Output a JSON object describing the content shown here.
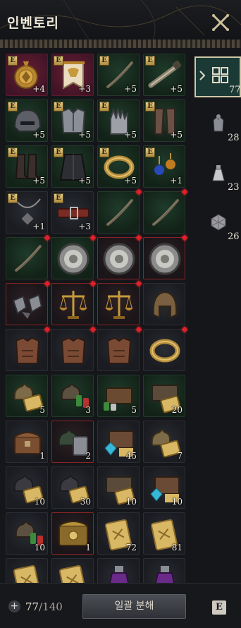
{
  "window": {
    "title": "인벤토리"
  },
  "footer": {
    "count": "77",
    "max": "/140",
    "button_label": "일괄 분해",
    "key_hint": "E"
  },
  "badge_text": "E",
  "colors": {
    "new_marker": "#e0202a",
    "selected_border": "#8a2426",
    "accent_teal": "#1c3a35",
    "badge_gold": "#d8b864"
  },
  "sidebar": {
    "tabs": [
      {
        "icon": "grid-icon",
        "count": "77",
        "active": true
      },
      {
        "icon": "armor-icon",
        "count": "28",
        "active": false
      },
      {
        "icon": "potion-icon",
        "count": "23",
        "active": false
      },
      {
        "icon": "dice-icon",
        "count": "26",
        "active": false
      }
    ]
  },
  "items": [
    {
      "icon": "medallion",
      "bg": "crim",
      "badge": true,
      "count": "+4",
      "new": false
    },
    {
      "icon": "banner",
      "bg": "crim",
      "badge": true,
      "count": "+3",
      "new": false
    },
    {
      "icon": "bow",
      "bg": "green",
      "badge": true,
      "count": "+5",
      "new": false
    },
    {
      "icon": "spyglass",
      "bg": "green",
      "badge": true,
      "count": "+5",
      "new": false
    },
    {
      "icon": "helmet-round",
      "bg": "green",
      "badge": true,
      "count": "+5",
      "new": false
    },
    {
      "icon": "chestplate",
      "bg": "green",
      "badge": true,
      "count": "+5",
      "new": false
    },
    {
      "icon": "gauntlet",
      "bg": "green",
      "badge": true,
      "count": "+5",
      "new": false
    },
    {
      "icon": "greaves",
      "bg": "green",
      "badge": true,
      "count": "+5",
      "new": false
    },
    {
      "icon": "boots",
      "bg": "green",
      "badge": true,
      "count": "+5",
      "new": false
    },
    {
      "icon": "cloak",
      "bg": "green",
      "badge": true,
      "count": "+5",
      "new": false
    },
    {
      "icon": "ring",
      "bg": "green",
      "badge": true,
      "count": "+5",
      "new": false
    },
    {
      "icon": "earring",
      "bg": "green",
      "badge": true,
      "count": "+1",
      "new": false
    },
    {
      "icon": "necklace",
      "bg": "dark",
      "badge": true,
      "count": "+1",
      "new": false
    },
    {
      "icon": "belt",
      "bg": "dark",
      "badge": true,
      "count": "+3",
      "new": false
    },
    {
      "icon": "bow",
      "bg": "green",
      "badge": false,
      "count": "",
      "new": true
    },
    {
      "icon": "bow",
      "bg": "green",
      "badge": false,
      "count": "",
      "new": true
    },
    {
      "icon": "bow",
      "bg": "green",
      "badge": false,
      "count": "",
      "new": true
    },
    {
      "icon": "shield",
      "bg": "green",
      "badge": false,
      "count": "",
      "new": true
    },
    {
      "icon": "shield",
      "bg": "red",
      "badge": false,
      "count": "",
      "new": true
    },
    {
      "icon": "shield",
      "bg": "red",
      "badge": false,
      "count": "",
      "new": true
    },
    {
      "icon": "gauntlet-pair",
      "bg": "red",
      "badge": false,
      "count": "",
      "new": true
    },
    {
      "icon": "scales",
      "bg": "red",
      "badge": false,
      "count": "",
      "new": true
    },
    {
      "icon": "scales",
      "bg": "red",
      "badge": false,
      "count": "",
      "new": true
    },
    {
      "icon": "helmet-crest",
      "bg": "dark",
      "badge": false,
      "count": "",
      "new": false
    },
    {
      "icon": "leather-armor",
      "bg": "dark",
      "badge": false,
      "count": "",
      "new": true
    },
    {
      "icon": "leather-armor",
      "bg": "dark",
      "badge": false,
      "count": "",
      "new": true
    },
    {
      "icon": "leather-armor",
      "bg": "dark",
      "badge": false,
      "count": "",
      "new": true
    },
    {
      "icon": "ring",
      "bg": "dark",
      "badge": false,
      "count": "",
      "new": true
    },
    {
      "icon": "pouch-scroll",
      "bg": "green",
      "badge": false,
      "count": "5",
      "new": false
    },
    {
      "icon": "pouch-bottles",
      "bg": "green",
      "badge": false,
      "count": "3",
      "new": false
    },
    {
      "icon": "chest-bottles",
      "bg": "green",
      "badge": false,
      "count": "5",
      "new": false
    },
    {
      "icon": "chest-scroll",
      "bg": "green",
      "badge": false,
      "count": "20",
      "new": false
    },
    {
      "icon": "chest",
      "bg": "dark",
      "badge": false,
      "count": "1",
      "new": false
    },
    {
      "icon": "pouch-card",
      "bg": "red",
      "badge": false,
      "count": "2",
      "new": false
    },
    {
      "icon": "chest-gems",
      "bg": "dark",
      "badge": false,
      "count": "45",
      "new": false
    },
    {
      "icon": "pouch-scroll",
      "bg": "dark",
      "badge": false,
      "count": "7",
      "new": false
    },
    {
      "icon": "pouch-scroll-dark",
      "bg": "dark",
      "badge": false,
      "count": "10",
      "new": false
    },
    {
      "icon": "pouch-scroll-dark",
      "bg": "dark",
      "badge": false,
      "count": "30",
      "new": false
    },
    {
      "icon": "chest-scroll",
      "bg": "dark",
      "badge": false,
      "count": "10",
      "new": false
    },
    {
      "icon": "chest-gems",
      "bg": "dark",
      "badge": false,
      "count": "10",
      "new": false
    },
    {
      "icon": "pouch-bottles",
      "bg": "dark",
      "badge": false,
      "count": "10",
      "new": false
    },
    {
      "icon": "gold-chest",
      "bg": "red",
      "badge": false,
      "count": "1",
      "new": false
    },
    {
      "icon": "scroll",
      "bg": "dark",
      "badge": false,
      "count": "72",
      "new": false
    },
    {
      "icon": "scroll",
      "bg": "dark",
      "badge": false,
      "count": "81",
      "new": false
    },
    {
      "icon": "scroll",
      "bg": "dark",
      "badge": false,
      "count": "",
      "new": false
    },
    {
      "icon": "scroll",
      "bg": "dark",
      "badge": false,
      "count": "",
      "new": false
    },
    {
      "icon": "potion-vial",
      "bg": "dark",
      "badge": false,
      "count": "",
      "new": false
    },
    {
      "icon": "potion-vial",
      "bg": "dark",
      "badge": false,
      "count": "",
      "new": false
    }
  ]
}
